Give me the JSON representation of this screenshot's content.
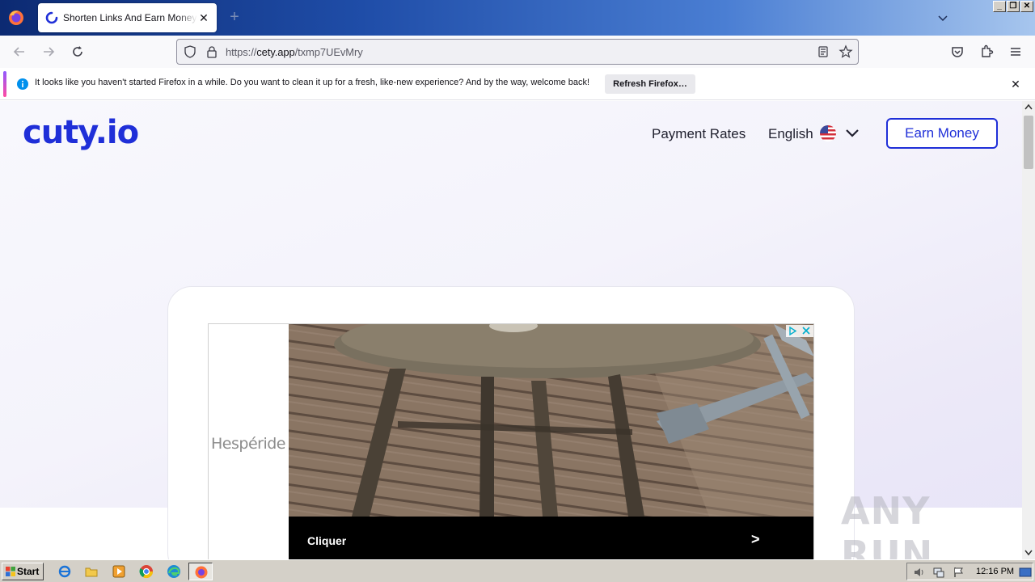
{
  "browser": {
    "tab_title": "Shorten Links And Earn Money | cuty.io",
    "url_prefix": "https://",
    "url_domain": "cety.app",
    "url_path": "/txmp7UEvMry",
    "new_tab_symbol": "+",
    "tab_close_symbol": "✕",
    "window_buttons": [
      "_",
      "❐",
      "✕"
    ]
  },
  "notification": {
    "message": "It looks like you haven't started Firefox in a while. Do you want to clean it up for a fresh, like-new experience? And by the way, welcome back!",
    "button_label": "Refresh Firefox…",
    "close_symbol": "✕"
  },
  "site": {
    "logo": "cuty.io",
    "nav": {
      "payment_rates": "Payment Rates",
      "language": "English",
      "earn_money": "Earn Money"
    },
    "brand_color": "#1f2fd8"
  },
  "ad": {
    "brand": "Hespéride",
    "cta_label": "Cliquer",
    "cta_arrow": ">"
  },
  "watermark": "ANY RUN",
  "taskbar": {
    "start_label": "Start",
    "clock": "12:16 PM"
  }
}
